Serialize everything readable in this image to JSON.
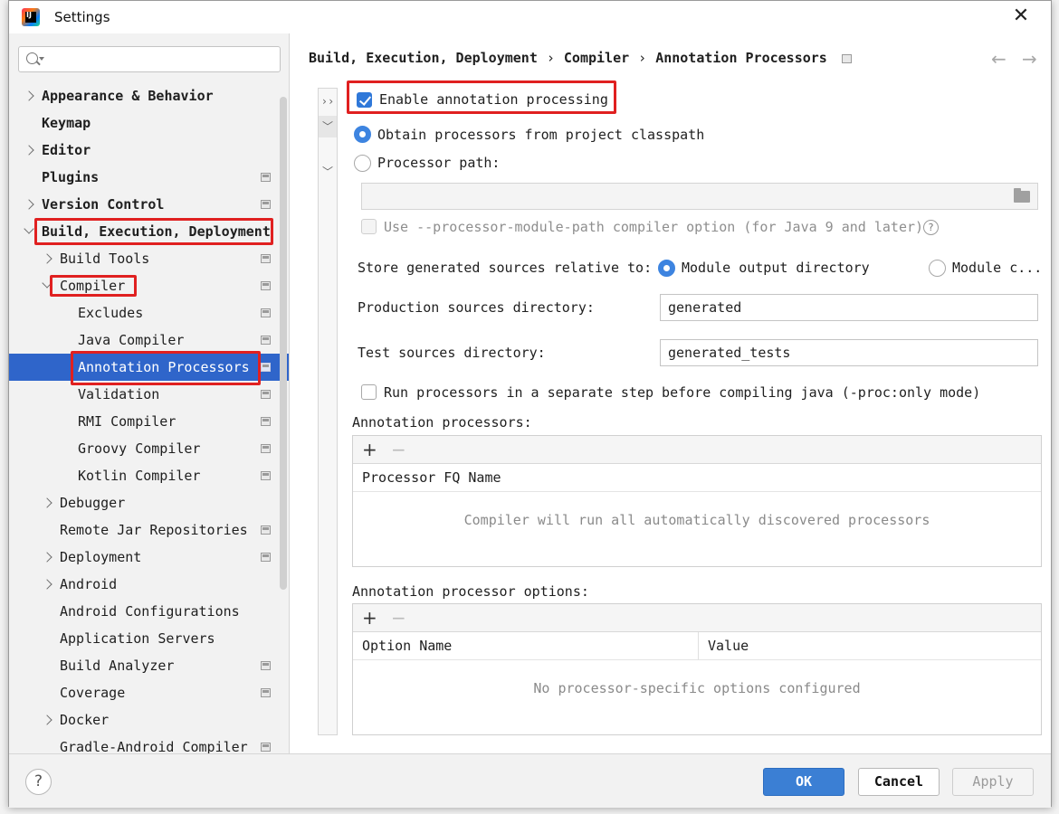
{
  "window": {
    "title": "Settings",
    "app_icon_text": "IJ"
  },
  "search": {
    "placeholder": ""
  },
  "sidebar": {
    "items": [
      {
        "label": "Appearance & Behavior"
      },
      {
        "label": "Keymap"
      },
      {
        "label": "Editor"
      },
      {
        "label": "Plugins"
      },
      {
        "label": "Version Control"
      },
      {
        "label": "Build, Execution, Deployment"
      },
      {
        "label": "Build Tools"
      },
      {
        "label": "Compiler"
      },
      {
        "label": "Excludes"
      },
      {
        "label": "Java Compiler"
      },
      {
        "label": "Annotation Processors"
      },
      {
        "label": "Validation"
      },
      {
        "label": "RMI Compiler"
      },
      {
        "label": "Groovy Compiler"
      },
      {
        "label": "Kotlin Compiler"
      },
      {
        "label": "Debugger"
      },
      {
        "label": "Remote Jar Repositories"
      },
      {
        "label": "Deployment"
      },
      {
        "label": "Android"
      },
      {
        "label": "Android Configurations"
      },
      {
        "label": "Application Servers"
      },
      {
        "label": "Build Analyzer"
      },
      {
        "label": "Coverage"
      },
      {
        "label": "Docker"
      },
      {
        "label": "Gradle-Android Compiler"
      }
    ]
  },
  "breadcrumb": {
    "part1": "Build, Execution, Deployment",
    "sep": "›",
    "part2": "Compiler",
    "part3": "Annotation Processors",
    "back": "←",
    "forward": "→"
  },
  "strip": {
    "expand": "››",
    "down1": "﹀",
    "down2": "﹀"
  },
  "form": {
    "enable_label": "Enable annotation processing",
    "obtain_classpath": "Obtain processors from project classpath",
    "processor_path": "Processor path:",
    "processor_path_value": "",
    "module_path_option": "Use --processor-module-path compiler option (for Java 9 and later)",
    "help_symbol": "?",
    "store_label": "Store generated sources relative to:",
    "module_output": "Module output directory",
    "module_content": "Module c...",
    "production_label": "Production sources directory:",
    "production_value": "generated",
    "test_label": "Test sources directory:",
    "test_value": "generated_tests",
    "run_separate": "Run processors in a separate step before compiling java (-proc:only mode)"
  },
  "processors_panel": {
    "title": "Annotation processors:",
    "add": "+",
    "remove": "−",
    "column": "Processor FQ Name",
    "empty": "Compiler will run all automatically discovered processors"
  },
  "options_panel": {
    "title": "Annotation processor options:",
    "add": "+",
    "remove": "−",
    "col_name": "Option Name",
    "col_value": "Value",
    "empty": "No processor-specific options configured"
  },
  "footer": {
    "help": "?",
    "ok": "OK",
    "cancel": "Cancel",
    "apply": "Apply"
  },
  "colors": {
    "accent": "#2f65ca",
    "highlight_box": "#e02020",
    "ok_button": "#3b7fd4"
  }
}
